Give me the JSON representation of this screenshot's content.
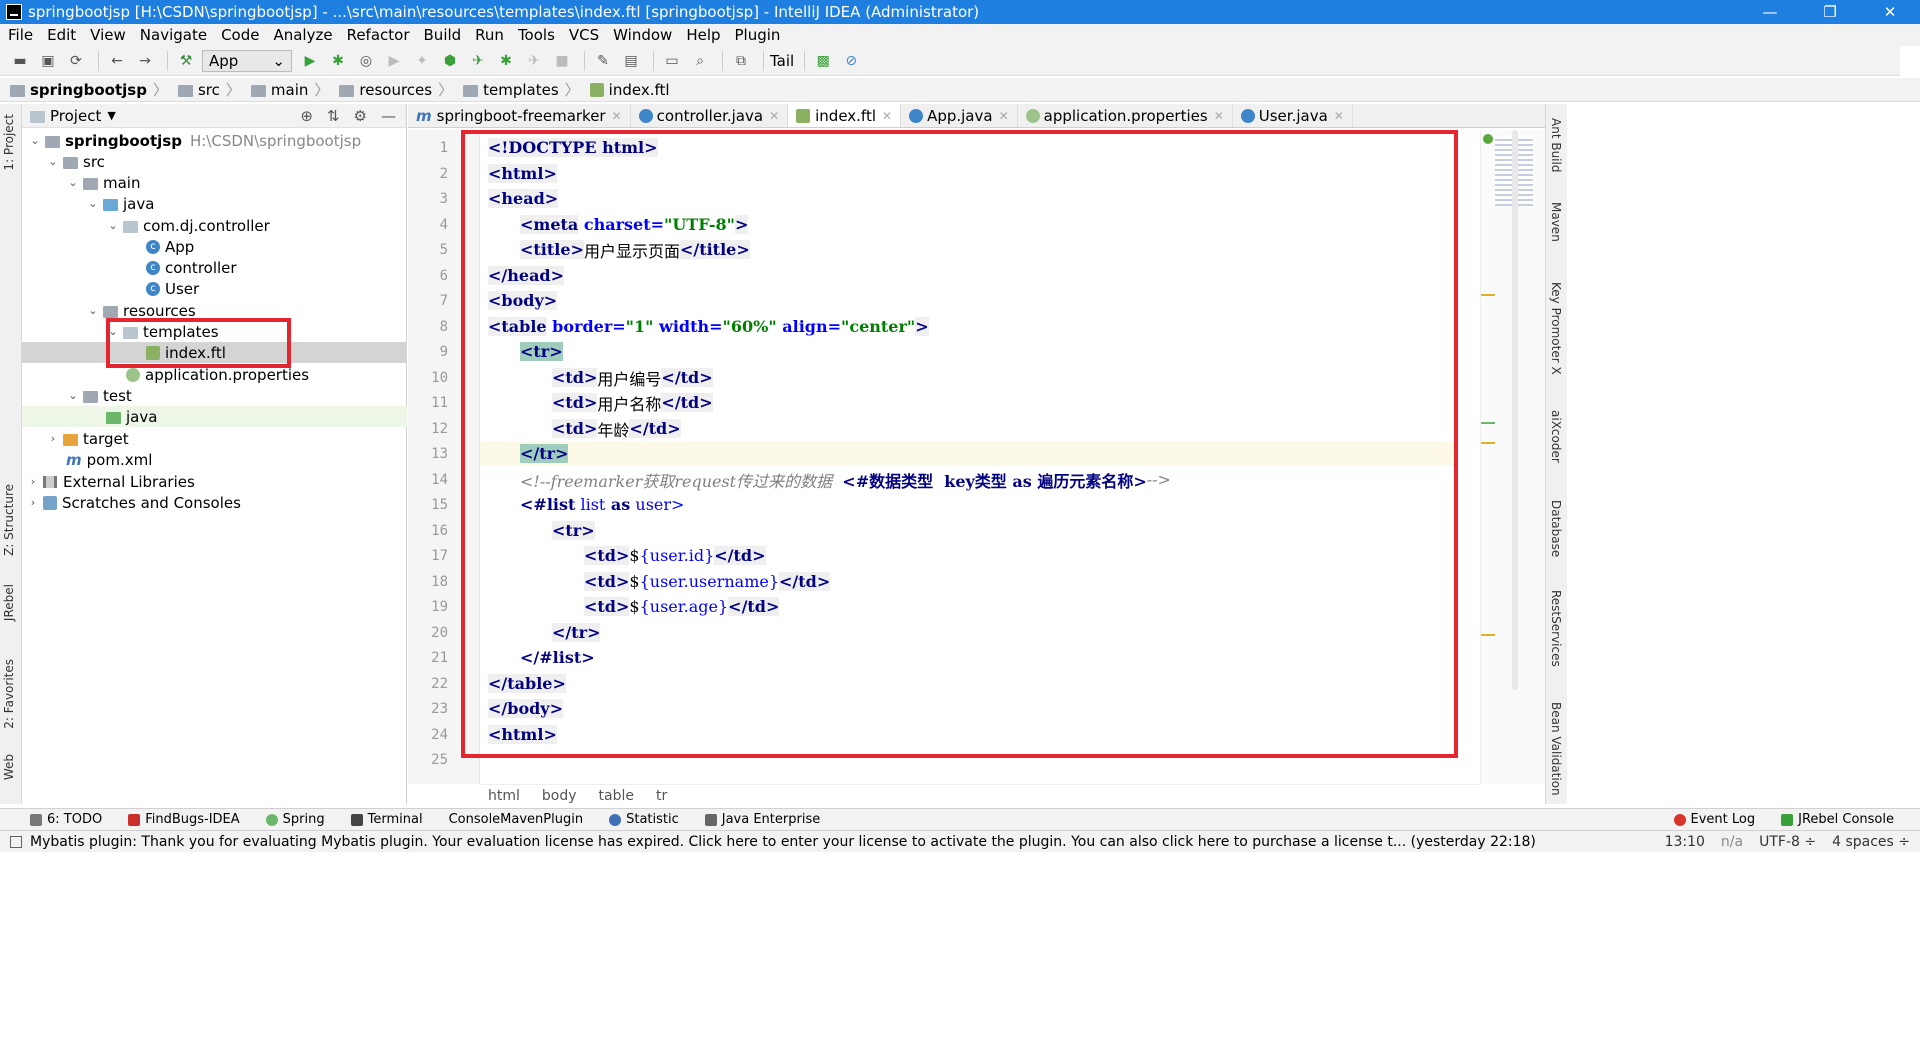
{
  "titlebar": {
    "title": "springbootjsp [H:\\CSDN\\springbootjsp] - ...\\src\\main\\resources\\templates\\index.ftl [springbootjsp] - IntelliJ IDEA (Administrator)",
    "minimize": "—",
    "maximize": "❐",
    "close": "✕"
  },
  "menu": [
    "File",
    "Edit",
    "View",
    "Navigate",
    "Code",
    "Analyze",
    "Refactor",
    "Build",
    "Run",
    "Tools",
    "VCS",
    "Window",
    "Help",
    "Plugin"
  ],
  "toolbar": {
    "run_config": "App",
    "tail": "Tail"
  },
  "breadcrumbs": [
    "springbootjsp",
    "src",
    "main",
    "resources",
    "templates",
    "index.ftl"
  ],
  "project_panel": {
    "title": "Project",
    "tree": [
      {
        "label": "springbootjsp",
        "path": "H:\\CSDN\\springbootjsp"
      },
      {
        "label": "src"
      },
      {
        "label": "main"
      },
      {
        "label": "java"
      },
      {
        "label": "com.dj.controller"
      },
      {
        "label": "App"
      },
      {
        "label": "controller"
      },
      {
        "label": "User"
      },
      {
        "label": "resources"
      },
      {
        "label": "templates"
      },
      {
        "label": "index.ftl"
      },
      {
        "label": "application.properties"
      },
      {
        "label": "test"
      },
      {
        "label": "java"
      },
      {
        "label": "target"
      },
      {
        "label": "pom.xml"
      },
      {
        "label": "External Libraries"
      },
      {
        "label": "Scratches and Consoles"
      }
    ]
  },
  "editor_tabs": [
    {
      "label": "springboot-freemarker",
      "color": "#7a6fd0"
    },
    {
      "label": "controller.java",
      "color": "#3e86c9"
    },
    {
      "label": "index.ftl",
      "color": "#8ab162"
    },
    {
      "label": "App.java",
      "color": "#3e86c9"
    },
    {
      "label": "application.properties",
      "color": "#9cc48a"
    },
    {
      "label": "User.java",
      "color": "#3e86c9"
    }
  ],
  "code": {
    "l1": "<!DOCTYPE html>",
    "l2": "<html>",
    "l3": "<head>",
    "l4a": "<meta",
    "l4b": " charset=",
    "l4c": "\"UTF-8\"",
    "l4d": ">",
    "l5a": "<title>",
    "l5b": "用户显示页面",
    "l5c": "</title>",
    "l6": "</head>",
    "l7": "<body>",
    "l8a": "<table",
    "l8b": " border=",
    "l8c": "\"1\"",
    "l8d": " width=",
    "l8e": "\"60%\"",
    "l8f": " align=",
    "l8g": "\"center\"",
    "l8h": ">",
    "l9": "<tr>",
    "l10a": "<td>",
    "l10b": "用户编号",
    "l10c": "</td>",
    "l11a": "<td>",
    "l11b": "用户名称",
    "l11c": "</td>",
    "l12a": "<td>",
    "l12b": "年龄",
    "l12c": "</td>",
    "l13": "</tr>",
    "l14a": "<!--freemarker获取request传过来的数据  ",
    "l14b": "<#数据类型  key类型 as 遍历元素名称>",
    "l14c": "-->",
    "l15a": "<#list",
    "l15b": " list",
    "l15c": " as",
    "l15d": " user>",
    "l16": "<tr>",
    "l17a": "<td>",
    "l17b": "$",
    "l17c": "{user.id}",
    "l17d": "</td>",
    "l18a": "<td>",
    "l18b": "$",
    "l18c": "{user.username}",
    "l18d": "</td>",
    "l19a": "<td>",
    "l19b": "$",
    "l19c": "{user.age}",
    "l19d": "</td>",
    "l20": "</tr>",
    "l21": "</#list>",
    "l22": "</table>",
    "l23": "</body>",
    "l24": "<html>"
  },
  "code_breadcrumbs": [
    "html",
    "body",
    "table",
    "tr"
  ],
  "right_tools": [
    "Ant Build",
    "Maven",
    "Key Promoter X",
    "aiXcoder",
    "Database",
    "RestServices",
    "Bean Validation"
  ],
  "left_tools": [
    "1: Project",
    "Z: Structure",
    "JRebel",
    "2: Favorites",
    "Web"
  ],
  "bottom_tools": [
    "6: TODO",
    "FindBugs-IDEA",
    "Spring",
    "Terminal",
    "ConsoleMavenPlugin",
    "Statistic",
    "Java Enterprise",
    "Event Log",
    "JRebel Console"
  ],
  "status": {
    "message": "Mybatis plugin: Thank you for evaluating Mybatis plugin. Your evaluation license has expired. Click here to enter your license to activate the plugin. You can also click here to purchase a license t... (yesterday 22:18)",
    "position": "13:10",
    "na": "n/a",
    "encoding": "UTF-8 ÷",
    "indent": "4 spaces ÷"
  }
}
